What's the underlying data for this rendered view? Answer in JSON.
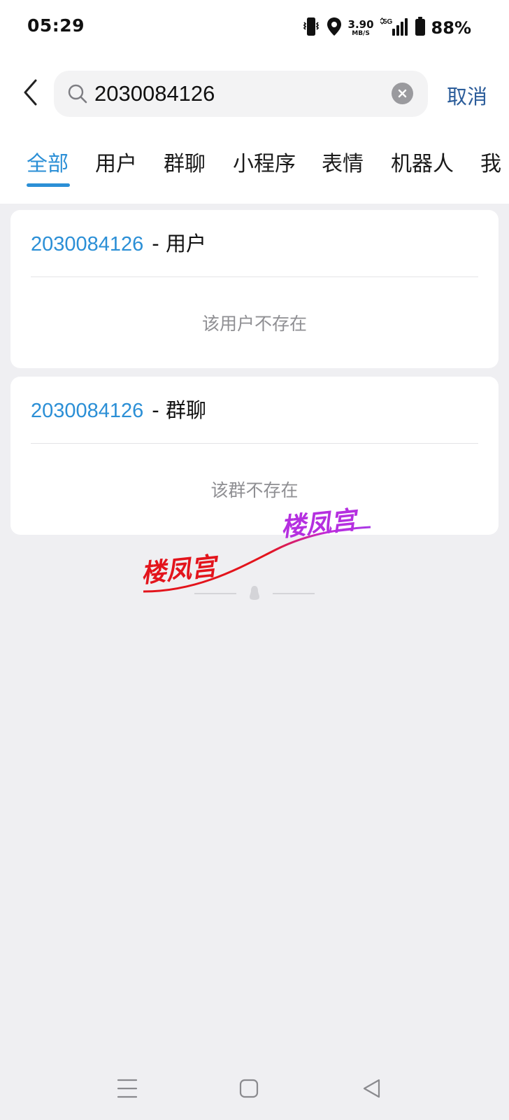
{
  "status_bar": {
    "time": "05:29",
    "speed_value": "3.90",
    "speed_unit": "MB/S",
    "network": "5G",
    "battery": "88%",
    "icons": [
      "vibrate-icon",
      "location-icon",
      "signal-icon",
      "battery-icon"
    ]
  },
  "search": {
    "query": "2030084126",
    "cancel_label": "取消"
  },
  "tabs": {
    "items": [
      "全部",
      "用户",
      "群聊",
      "小程序",
      "表情",
      "机器人",
      "我"
    ],
    "active": "全部"
  },
  "results": [
    {
      "query": "2030084126",
      "category": "- 用户",
      "empty_text": "该用户不存在"
    },
    {
      "query": "2030084126",
      "category": "- 群聊",
      "empty_text": "该群不存在"
    }
  ],
  "watermark": {
    "text": "楼凤宫"
  },
  "colors": {
    "accent": "#2b8fd6",
    "cancel": "#2c5d9a",
    "background": "#efeff2",
    "card": "#ffffff",
    "muted_text": "#8f8f93"
  }
}
